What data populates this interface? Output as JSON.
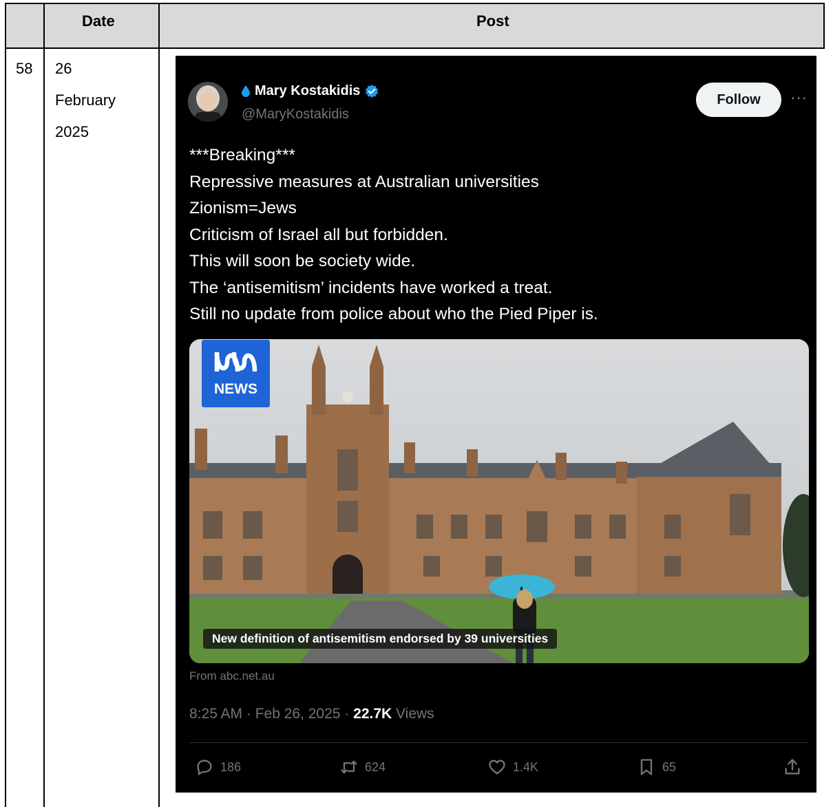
{
  "table": {
    "headers": {
      "num": "",
      "date": "Date",
      "post": "Post"
    },
    "row": {
      "num": "58",
      "date_lines": [
        "26",
        "February",
        "2025"
      ]
    }
  },
  "tweet": {
    "display_name": "Mary Kostakidis",
    "handle": "@MaryKostakidis",
    "follow_label": "Follow",
    "more_label": "···",
    "body_lines": [
      "***Breaking***",
      "Repressive measures at Australian universities",
      "Zionism=Jews",
      "Criticism of Israel all but forbidden.",
      "This will soon be society wide.",
      "The ‘antisemitism’ incidents have worked a treat.",
      "Still no update from police about who the Pied Piper is."
    ],
    "card": {
      "logo_text": "NEWS",
      "caption": "New definition of antisemitism endorsed by 39 universities",
      "source": "From abc.net.au"
    },
    "meta": {
      "time_date": "8:25 AM · Feb 26, 2025 · ",
      "views_count": "22.7K",
      "views_label": " Views"
    },
    "actions": {
      "replies": "186",
      "reposts": "624",
      "likes": "1.4K",
      "bookmarks": "65"
    }
  },
  "colors": {
    "header_bg": "#d9d9d9",
    "tweet_bg": "#000000",
    "muted_text": "#71767b",
    "verified_blue": "#1d9bf0",
    "abc_blue": "#1e64d6"
  }
}
